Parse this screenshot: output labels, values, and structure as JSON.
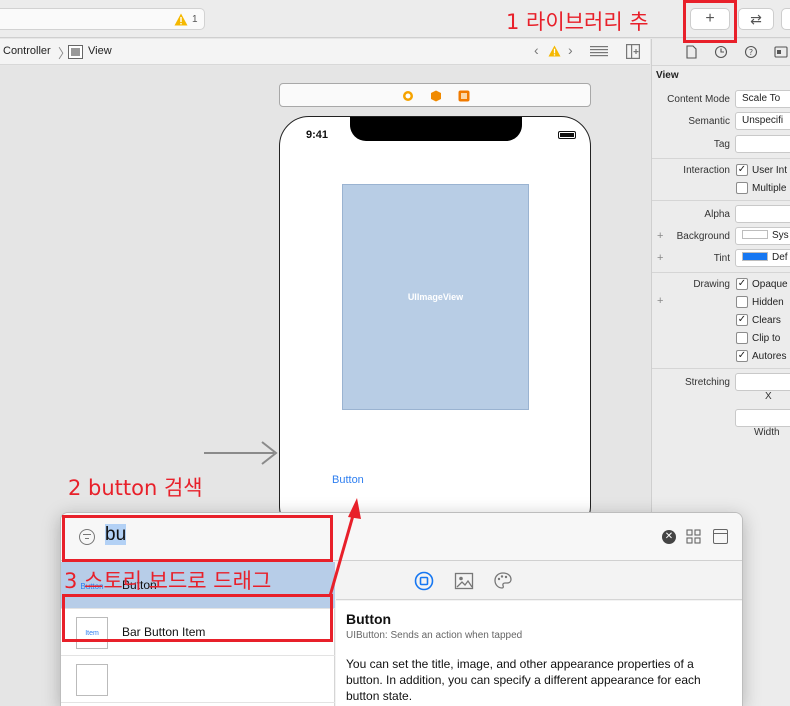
{
  "toolbar": {
    "warning_count": "1",
    "add_label": "+",
    "swap_label": "⇄"
  },
  "jumpbar": {
    "crumb_controller": "Controller",
    "crumb_view": "View"
  },
  "canvas": {
    "time": "9:41",
    "imageview_label": "UIImageView",
    "button_label": "Button"
  },
  "inspector": {
    "section_title": "View",
    "content_mode_label": "Content Mode",
    "content_mode_value": "Scale To",
    "semantic_label": "Semantic",
    "semantic_value": "Unspecifi",
    "tag_label": "Tag",
    "interaction_label": "Interaction",
    "interaction_opt1": "User Int",
    "interaction_opt2": "Multiple",
    "alpha_label": "Alpha",
    "background_label": "Background",
    "background_value": "Sys",
    "tint_label": "Tint",
    "tint_value": "Def",
    "tint_color": "#1677f2",
    "drawing_label": "Drawing",
    "drawing_opt1": "Opaque",
    "drawing_opt2": "Hidden",
    "drawing_opt3": "Clears",
    "drawing_opt4": "Clip to",
    "drawing_opt5": "Autores",
    "stretching_label": "Stretching",
    "x_label": "X",
    "width_label": "Width"
  },
  "library": {
    "search_value": "bu",
    "items": [
      {
        "thumb": "Button",
        "name": "Button"
      },
      {
        "thumb": "Item",
        "name": "Bar Button Item"
      },
      {
        "thumb": "",
        "name": ""
      }
    ],
    "detail_title": "Button",
    "detail_subtitle": "UIButton: Sends an action when tapped",
    "detail_desc": "You can set the title, image, and other appearance properties of a button. In addition, you can specify a different appearance for each button state."
  },
  "annotations": {
    "step1": "1 라이브러리 추",
    "step2": "2 button 검색",
    "step3": "3 스토리 보드로 드래그",
    "color": "#e8202a"
  }
}
